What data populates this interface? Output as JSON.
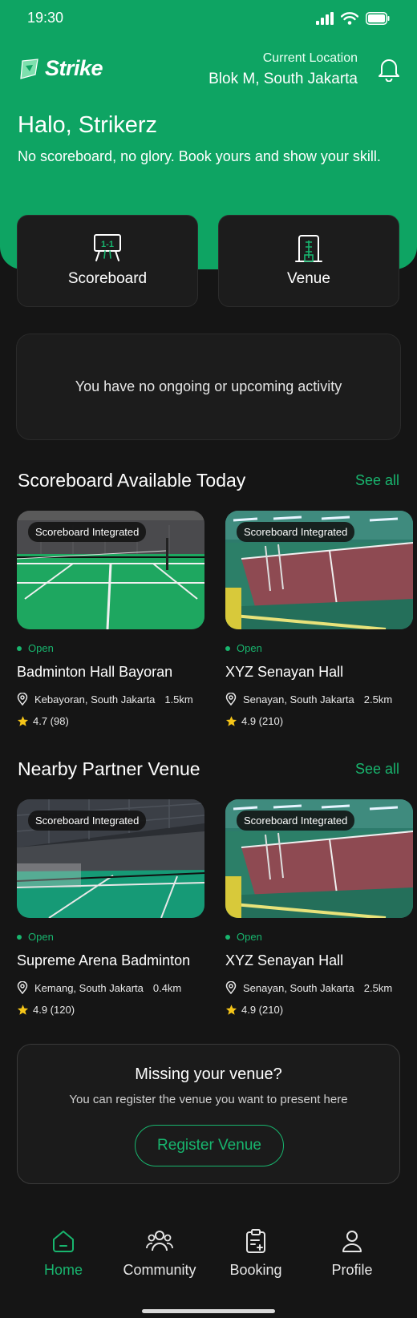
{
  "status_bar": {
    "time": "19:30"
  },
  "app": {
    "brand": "Strike"
  },
  "location": {
    "label": "Current Location",
    "value": "Blok M, South Jakarta"
  },
  "greeting": {
    "title": "Halo, Strikerz",
    "tagline": "No scoreboard, no glory. Book yours and show your skill."
  },
  "quick_actions": [
    {
      "label": "Scoreboard",
      "icon": "scoreboard-icon"
    },
    {
      "label": "Venue",
      "icon": "venue-icon"
    }
  ],
  "activity": {
    "empty_text": "You have no ongoing or upcoming activity"
  },
  "sections": {
    "scoreboard_today": {
      "title": "Scoreboard Available Today",
      "see_all": "See all",
      "venues": [
        {
          "badge": "Scoreboard Integrated",
          "status": "Open",
          "name": "Badminton Hall Bayoran",
          "location": "Kebayoran, South Jakarta",
          "distance": "1.5km",
          "rating": "4.7 (98)"
        },
        {
          "badge": "Scoreboard Integrated",
          "status": "Open",
          "name": "XYZ Senayan Hall",
          "location": "Senayan, South Jakarta",
          "distance": "2.5km",
          "rating": "4.9 (210)"
        }
      ]
    },
    "nearby_partner": {
      "title": "Nearby Partner Venue",
      "see_all": "See all",
      "venues": [
        {
          "badge": "Scoreboard Integrated",
          "status": "Open",
          "name": "Supreme Arena Badminton",
          "location": "Kemang, South Jakarta",
          "distance": "0.4km",
          "rating": "4.9 (120)"
        },
        {
          "badge": "Scoreboard Integrated",
          "status": "Open",
          "name": "XYZ Senayan Hall",
          "location": "Senayan, South Jakarta",
          "distance": "2.5km",
          "rating": "4.9 (210)"
        }
      ]
    }
  },
  "missing_venue": {
    "title": "Missing your venue?",
    "subtitle": "You can register the venue you want to present here",
    "button": "Register Venue"
  },
  "bottom_nav": [
    {
      "label": "Home",
      "icon": "home-icon",
      "active": true
    },
    {
      "label": "Community",
      "icon": "community-icon",
      "active": false
    },
    {
      "label": "Booking",
      "icon": "booking-icon",
      "active": false
    },
    {
      "label": "Profile",
      "icon": "profile-icon",
      "active": false
    }
  ],
  "colors": {
    "brand_green": "#0ea463",
    "accent_green": "#18b56e",
    "background": "#151515",
    "card": "#1c1c1c",
    "star": "#f5c518"
  }
}
